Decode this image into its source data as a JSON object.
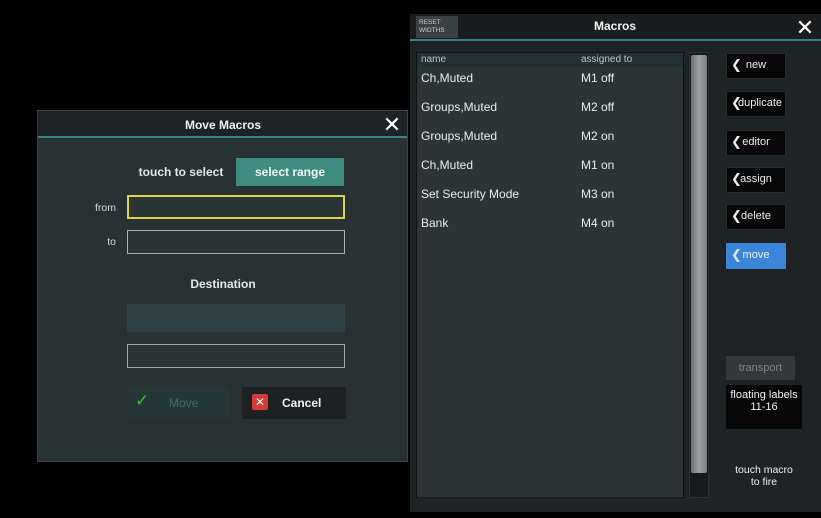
{
  "macros_panel": {
    "reset_widths_line1": "RESET",
    "reset_widths_line2": "WIDTHS",
    "title": "Macros",
    "close_glyph": "✕",
    "columns": {
      "name": "name",
      "assigned": "assigned to"
    },
    "rows": [
      {
        "name": "Ch,Muted",
        "assigned": "M1 off"
      },
      {
        "name": "Groups,Muted",
        "assigned": "M2 off"
      },
      {
        "name": "Groups,Muted",
        "assigned": "M2 on"
      },
      {
        "name": "Ch,Muted",
        "assigned": "M1 on"
      },
      {
        "name": "Set Security Mode",
        "assigned": "M3 on"
      },
      {
        "name": "Bank",
        "assigned": "M4 on"
      }
    ],
    "side_buttons": {
      "new": "new",
      "duplicate": "duplicate",
      "editor": "editor",
      "assign": "assign",
      "delete": "delete",
      "move": "move"
    },
    "transport": "transport",
    "floating_labels_line1": "floating labels",
    "floating_labels_line2": "11-16",
    "touch_macro_line1": "touch macro",
    "touch_macro_line2": "to fire"
  },
  "move_dialog": {
    "title": "Move Macros",
    "close_glyph": "✕",
    "touch_to_select": "touch to select",
    "select_range": "select range",
    "from_label": "from",
    "to_label": "to",
    "destination": "Destination",
    "move_button": "Move",
    "cancel_button": "Cancel"
  },
  "colors": {
    "accent_teal": "#3e8c80",
    "move_active_blue": "#3b86d9",
    "from_focus_yellow": "#d9d24a",
    "cancel_red": "#d63a3a",
    "check_green": "#3fbf3f"
  }
}
